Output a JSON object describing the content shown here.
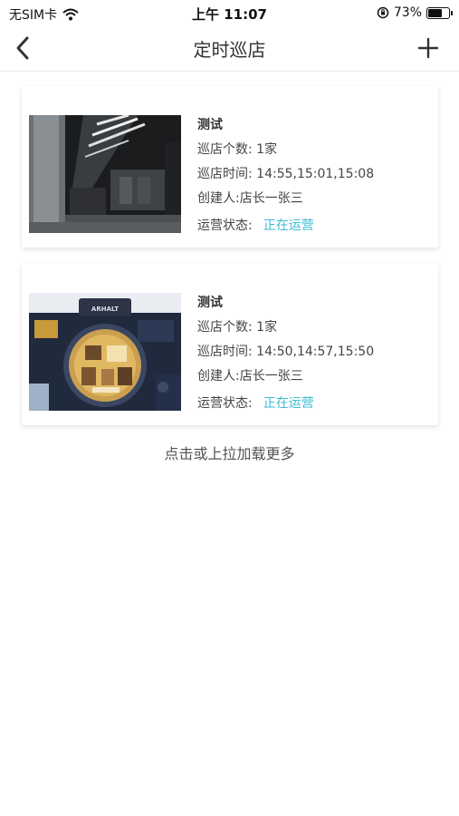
{
  "status_bar": {
    "carrier": "无SIM卡",
    "time": "上午 11:07",
    "battery": "73%",
    "battery_level": 0.73
  },
  "nav": {
    "title": "定时巡店",
    "back_icon": "chevron-left-icon",
    "add_icon": "plus-icon"
  },
  "items": [
    {
      "name": "测试",
      "store_count": "巡店个数: 1家",
      "times": "巡店时间: 14:55,15:01,15:08",
      "creator": "创建人:店长一张三",
      "status_label": "运营状态:",
      "status_value": "正在运营"
    },
    {
      "name": "测试",
      "store_count": "巡店个数: 1家",
      "times": "巡店时间: 14:50,14:57,15:50",
      "creator": "创建人:店长一张三",
      "status_label": "运营状态:",
      "status_value": "正在运营",
      "camera_brand": "ARHALT"
    }
  ],
  "load_more": "点击或上拉加载更多",
  "colors": {
    "status_active": "#3cbcd5"
  }
}
